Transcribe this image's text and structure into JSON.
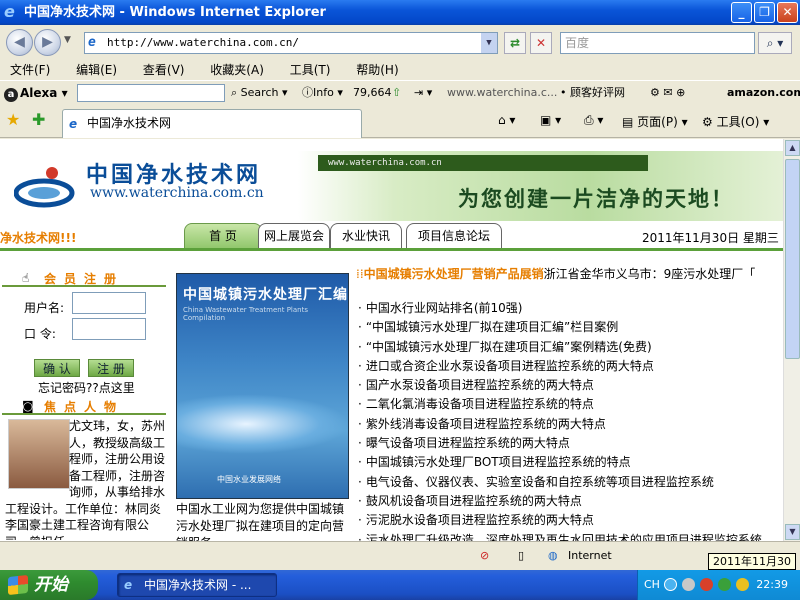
{
  "window": {
    "title": "中国净水技术网 - Windows Internet Explorer",
    "min": "_",
    "max": "❐",
    "close": "✕"
  },
  "address": {
    "url": "http://www.waterchina.com.cn/",
    "search_placeholder": "百度"
  },
  "menu": [
    "文件(F)",
    "编辑(E)",
    "查看(V)",
    "收藏夹(A)",
    "工具(T)",
    "帮助(H)"
  ],
  "alexa": {
    "brand": "Alexa",
    "search": "Search",
    "info": "Info",
    "rank": "79,664",
    "site": "www.waterchina.c...",
    "review": "顾客好评网",
    "amazon": "amazon.com."
  },
  "tabs": {
    "current": "中国净水技术网",
    "page": "页面(P)",
    "tools": "工具(O)"
  },
  "site": {
    "logo_name": "中国净水技术网",
    "logo_url": "www.waterchina.com.cn",
    "banner_url": "www.waterchina.com.cn",
    "slogan": "为您创建一片洁净的天地！",
    "marquee_left": "净水技术网!!!",
    "nav": [
      "首 页",
      "网上展览会",
      "水业快讯",
      "项目信息论坛"
    ],
    "date": "2011年11月30日 星期三",
    "member_title": "会员注册",
    "username_label": "用户名:",
    "password_label": "口 令:",
    "confirm_btn": "确 认",
    "register_btn": "注 册",
    "forgot": "忘记密码??点这里",
    "focus_title": "焦点人物",
    "bio": "尤文玮，女，苏州人，教授级高级工程师，注册公用设备工程师，注册咨询师，从事给排水工程设计。工作单位：林同炎李国豪土建工程咨询有限公司，曾担任",
    "book_title": "中国城镇污水处理厂汇编",
    "book_sub": "China Wastewater Treatment Plants Compilation",
    "book_bottom": "中国水业发展网络",
    "mid_text": "中国水工业网为您提供中国城镇污水处理厂拟在建项目的定向营销服务",
    "marquee_head": "中国城镇污水处理厂营销产品展销",
    "marquee_body": "浙江省金华市义乌市：9座污水处理厂「",
    "news": [
      "中国水行业网站排名(前10强)",
      "“中国城镇污水处理厂拟在建项目汇编”栏目案例",
      "“中国城镇污水处理厂拟在建项目汇编”案例精选(免费)",
      "进口或合资企业水泵设备项目进程监控系统的两大特点",
      "国产水泵设备项目进程监控系统的两大特点",
      "二氧化氯消毒设备项目进程监控系统的特点",
      "紫外线消毒设备项目进程监控系统的两大特点",
      "曝气设备项目进程监控系统的两大特点",
      "中国城镇污水处理厂BOT项目进程监控系统的特点",
      "电气设备、仪器仪表、实验室设备和自控系统等项目进程监控系统",
      "鼓风机设备项目进程监控系统的两大特点",
      "污泥脱水设备项目进程监控系统的两大特点",
      "污水处理厂升级改造、深度处理及再生水回用技术的应用项目进程监控系统"
    ]
  },
  "status": {
    "zone": "Internet",
    "tooltip": "2011年11月30日"
  },
  "taskbar": {
    "start": "开始",
    "item": "中国净水技术网 - ...",
    "lang": "CH",
    "clock": "22:39"
  }
}
